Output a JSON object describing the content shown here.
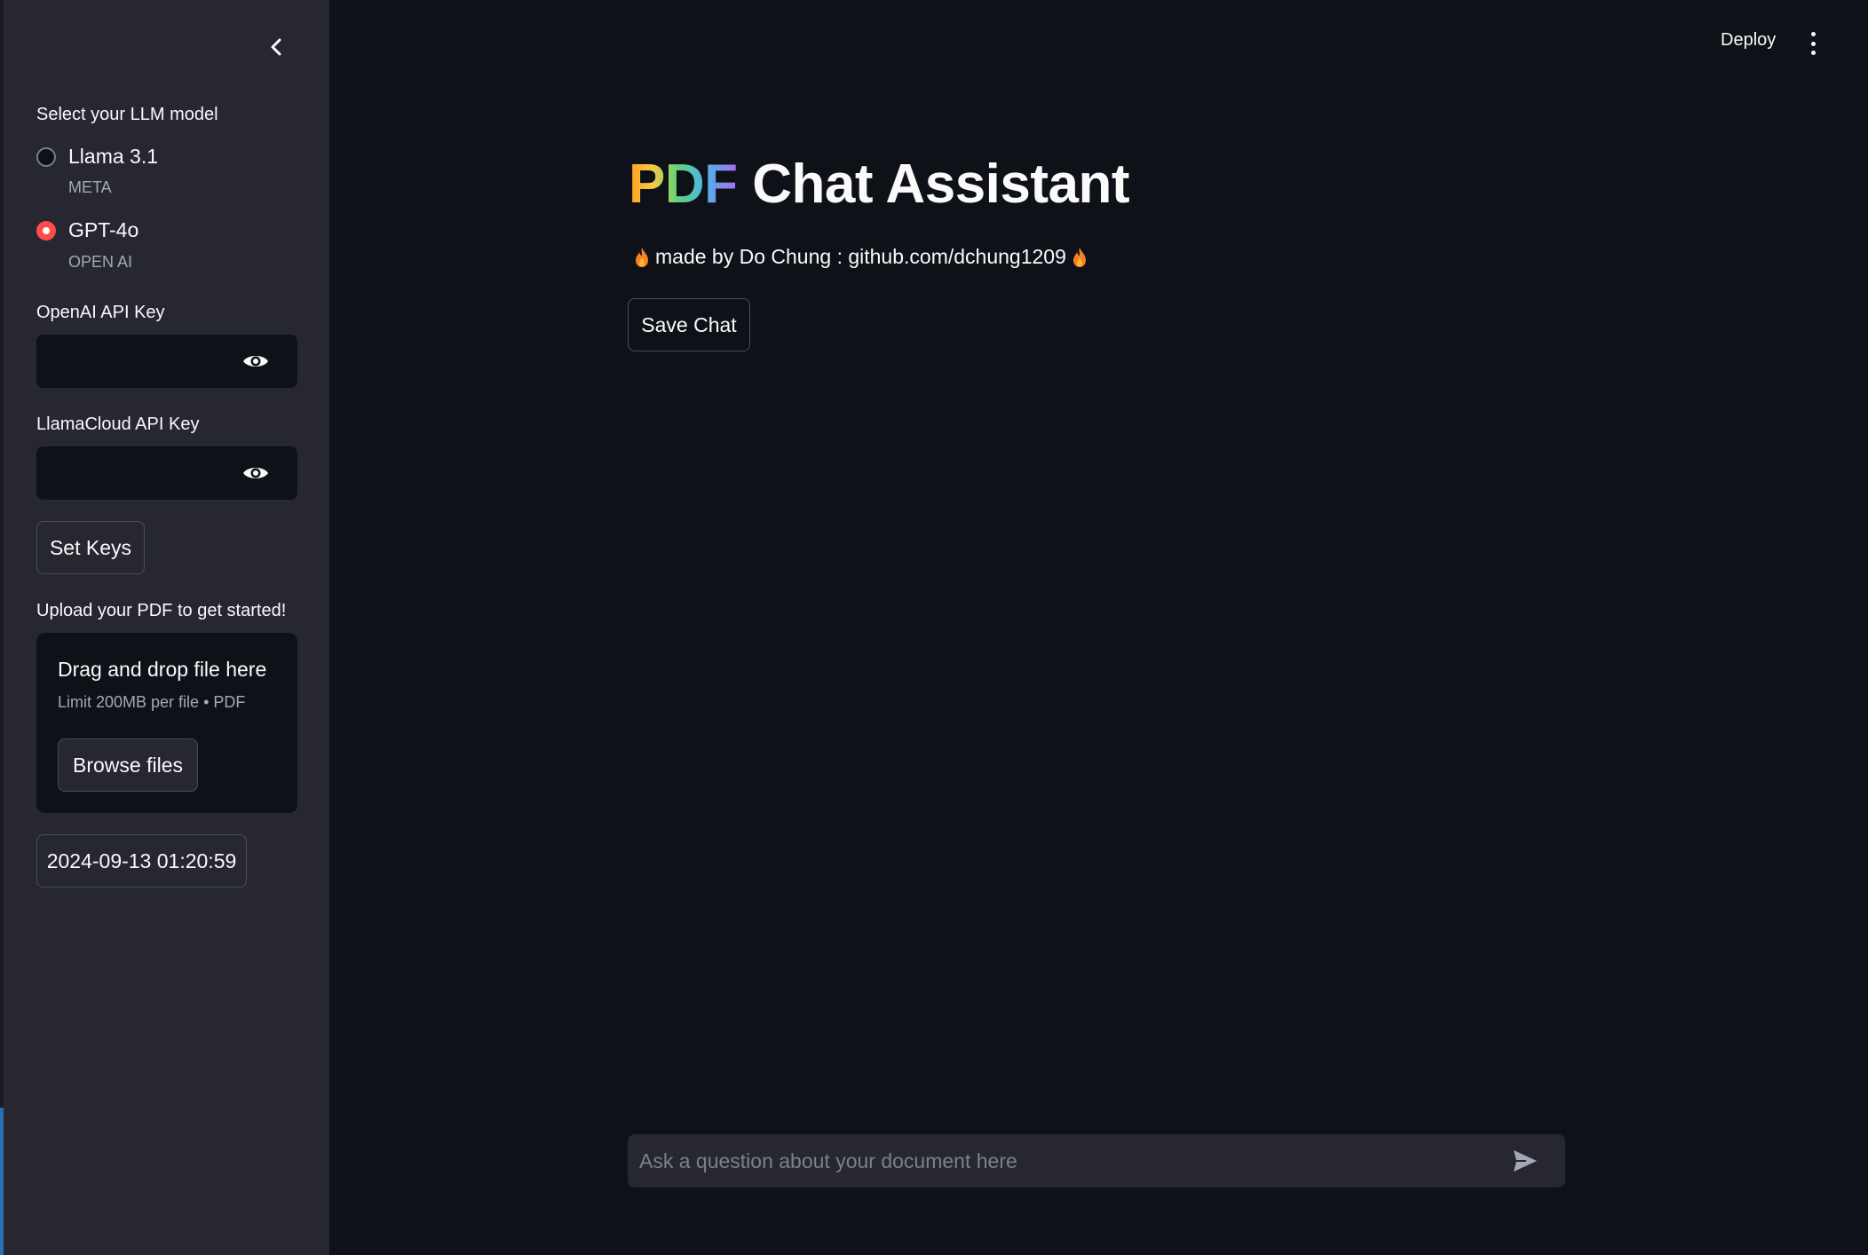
{
  "sidebar": {
    "collapse_icon": "chevron-left-icon",
    "model_select": {
      "label": "Select your LLM model",
      "options": [
        {
          "label": "Llama 3.1",
          "caption": "META",
          "selected": false
        },
        {
          "label": "GPT-4o",
          "caption": "OPEN AI",
          "selected": true
        }
      ]
    },
    "openai_key": {
      "label": "OpenAI API Key",
      "value": "",
      "icon": "eye-icon"
    },
    "llamacloud_key": {
      "label": "LlamaCloud API Key",
      "value": "",
      "icon": "eye-icon"
    },
    "set_keys_label": "Set Keys",
    "uploader": {
      "label": "Upload your PDF to get started!",
      "title": "Drag and drop file here",
      "limit": "Limit 200MB per file • PDF",
      "browse_label": "Browse files"
    },
    "timestamp_label": "2024-09-13 01:20:59"
  },
  "header": {
    "deploy_label": "Deploy",
    "menu_icon": "kebab-menu-icon"
  },
  "main": {
    "title_highlight": "PDF",
    "title_rest": "Chat Assistant",
    "byline": "made by Do Chung : github.com/dchung1209",
    "byline_icon": "fire-icon",
    "save_chat_label": "Save Chat"
  },
  "chat": {
    "placeholder": "Ask a question about your document here",
    "send_icon": "send-icon"
  },
  "colors": {
    "background": "#0e1117",
    "sidebar": "#262730",
    "accent": "#ff4b4b",
    "text": "#fafafa",
    "muted": "#a3a8b4"
  }
}
